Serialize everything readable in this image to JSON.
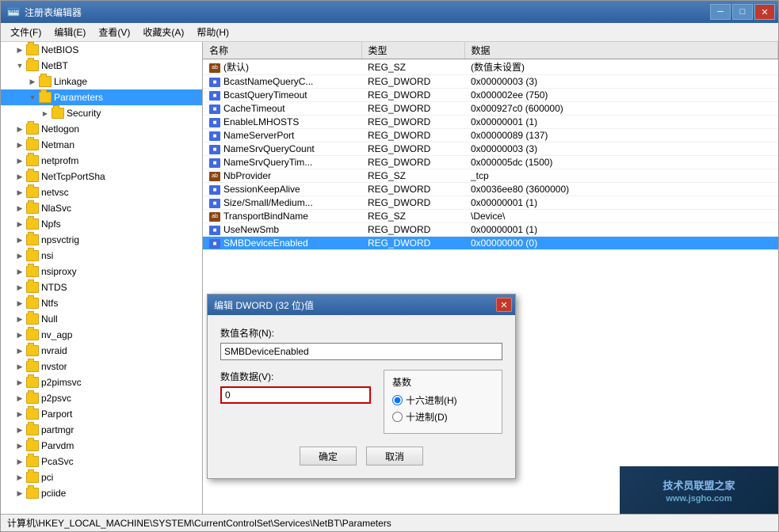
{
  "window": {
    "title": "注册表编辑器",
    "icon": "regedit-icon"
  },
  "titlebar_buttons": {
    "minimize": "─",
    "maximize": "□",
    "close": "✕"
  },
  "menu": {
    "items": [
      "文件(F)",
      "编辑(E)",
      "查看(V)",
      "收藏夹(A)",
      "帮助(H)"
    ]
  },
  "tree": {
    "items": [
      {
        "label": "NetBIOS",
        "indent": 1,
        "expanded": false,
        "selected": false
      },
      {
        "label": "NetBT",
        "indent": 1,
        "expanded": true,
        "selected": false
      },
      {
        "label": "Linkage",
        "indent": 2,
        "expanded": false,
        "selected": false
      },
      {
        "label": "Parameters",
        "indent": 2,
        "expanded": true,
        "selected": true
      },
      {
        "label": "Security",
        "indent": 3,
        "expanded": false,
        "selected": false
      },
      {
        "label": "Netlogon",
        "indent": 1,
        "expanded": false,
        "selected": false
      },
      {
        "label": "Netman",
        "indent": 1,
        "expanded": false,
        "selected": false
      },
      {
        "label": "netprofm",
        "indent": 1,
        "expanded": false,
        "selected": false
      },
      {
        "label": "NetTcpPortSha",
        "indent": 1,
        "expanded": false,
        "selected": false
      },
      {
        "label": "netvsc",
        "indent": 1,
        "expanded": false,
        "selected": false
      },
      {
        "label": "NlaSvc",
        "indent": 1,
        "expanded": false,
        "selected": false
      },
      {
        "label": "Npfs",
        "indent": 1,
        "expanded": false,
        "selected": false
      },
      {
        "label": "npsvctrig",
        "indent": 1,
        "expanded": false,
        "selected": false
      },
      {
        "label": "nsi",
        "indent": 1,
        "expanded": false,
        "selected": false
      },
      {
        "label": "nsiproxy",
        "indent": 1,
        "expanded": false,
        "selected": false
      },
      {
        "label": "NTDS",
        "indent": 1,
        "expanded": false,
        "selected": false
      },
      {
        "label": "Ntfs",
        "indent": 1,
        "expanded": false,
        "selected": false
      },
      {
        "label": "Null",
        "indent": 1,
        "expanded": false,
        "selected": false
      },
      {
        "label": "nv_agp",
        "indent": 1,
        "expanded": false,
        "selected": false
      },
      {
        "label": "nvraid",
        "indent": 1,
        "expanded": false,
        "selected": false
      },
      {
        "label": "nvstor",
        "indent": 1,
        "expanded": false,
        "selected": false
      },
      {
        "label": "p2pimsvc",
        "indent": 1,
        "expanded": false,
        "selected": false
      },
      {
        "label": "p2psvc",
        "indent": 1,
        "expanded": false,
        "selected": false
      },
      {
        "label": "Parport",
        "indent": 1,
        "expanded": false,
        "selected": false
      },
      {
        "label": "partmgr",
        "indent": 1,
        "expanded": false,
        "selected": false
      },
      {
        "label": "Parvdm",
        "indent": 1,
        "expanded": false,
        "selected": false
      },
      {
        "label": "PcaSvc",
        "indent": 1,
        "expanded": false,
        "selected": false
      },
      {
        "label": "pci",
        "indent": 1,
        "expanded": false,
        "selected": false
      },
      {
        "label": "pciide",
        "indent": 1,
        "expanded": false,
        "selected": false
      }
    ]
  },
  "table": {
    "columns": [
      "名称",
      "类型",
      "数据"
    ],
    "rows": [
      {
        "name": "(默认)",
        "type": "REG_SZ",
        "data": "(数值未设置)",
        "icon": "ab"
      },
      {
        "name": "BcastNameQueryC...",
        "type": "REG_DWORD",
        "data": "0x00000003 (3)",
        "icon": "dword"
      },
      {
        "name": "BcastQueryTimeout",
        "type": "REG_DWORD",
        "data": "0x000002ee (750)",
        "icon": "dword"
      },
      {
        "name": "CacheTimeout",
        "type": "REG_DWORD",
        "data": "0x000927c0 (600000)",
        "icon": "dword"
      },
      {
        "name": "EnableLMHOSTS",
        "type": "REG_DWORD",
        "data": "0x00000001 (1)",
        "icon": "dword"
      },
      {
        "name": "NameServerPort",
        "type": "REG_DWORD",
        "data": "0x00000089 (137)",
        "icon": "dword"
      },
      {
        "name": "NameSrvQueryCount",
        "type": "REG_DWORD",
        "data": "0x00000003 (3)",
        "icon": "dword"
      },
      {
        "name": "NameSrvQueryTim...",
        "type": "REG_DWORD",
        "data": "0x000005dc (1500)",
        "icon": "dword"
      },
      {
        "name": "NbProvider",
        "type": "REG_SZ",
        "data": "_tcp",
        "icon": "ab"
      },
      {
        "name": "SessionKeepAlive",
        "type": "REG_DWORD",
        "data": "0x0036ee80 (3600000)",
        "icon": "dword"
      },
      {
        "name": "Size/Small/Medium...",
        "type": "REG_DWORD",
        "data": "0x00000001 (1)",
        "icon": "dword"
      },
      {
        "name": "TransportBindName",
        "type": "REG_SZ",
        "data": "\\Device\\",
        "icon": "ab"
      },
      {
        "name": "UseNewSmb",
        "type": "REG_DWORD",
        "data": "0x00000001 (1)",
        "icon": "dword"
      },
      {
        "name": "SMBDeviceEnabled",
        "type": "REG_DWORD",
        "data": "0x00000000 (0)",
        "icon": "dword",
        "selected": true
      }
    ]
  },
  "dialog": {
    "title": "编辑 DWORD (32 位)值",
    "name_label": "数值名称(N):",
    "name_value": "SMBDeviceEnabled",
    "data_label": "数值数据(V):",
    "data_value": "0",
    "base_label": "基数",
    "hex_label": "十六进制(H)",
    "dec_label": "十进制(D)",
    "ok_label": "确定",
    "cancel_label": "取消"
  },
  "status": {
    "path": "计算机\\HKEY_LOCAL_MACHINE\\SYSTEM\\CurrentControlSet\\Services\\NetBT\\Parameters"
  },
  "watermark": {
    "site": "www.jsgho.com",
    "sub": "技术员联盟之家"
  }
}
